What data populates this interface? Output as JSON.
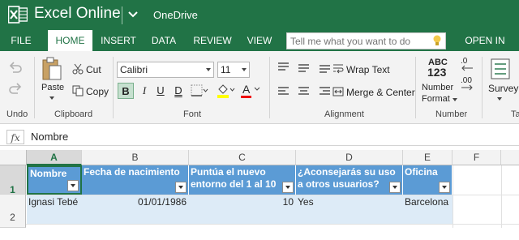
{
  "titlebar": {
    "app_title": "Excel Online",
    "onedrive": "OneDrive",
    "brand_color": "#217346"
  },
  "tabs": [
    {
      "label": "FILE"
    },
    {
      "label": "HOME"
    },
    {
      "label": "INSERT"
    },
    {
      "label": "DATA"
    },
    {
      "label": "REVIEW"
    },
    {
      "label": "VIEW"
    },
    {
      "label": "OPEN IN EXCEL"
    }
  ],
  "active_tab": "HOME",
  "tell_me": {
    "placeholder": "Tell me what you want to do"
  },
  "ribbon": {
    "undo_group": {
      "label": "Undo"
    },
    "clipboard": {
      "label": "Clipboard",
      "paste": "Paste",
      "cut": "Cut",
      "copy": "Copy"
    },
    "font": {
      "label": "Font",
      "font_name": "Calibri",
      "font_size": "11",
      "bold": "B",
      "italic": "I",
      "underline": "U",
      "double_underline": "D",
      "font_color": "A"
    },
    "alignment": {
      "label": "Alignment",
      "wrap_text": "Wrap Text",
      "merge_center": "Merge & Center"
    },
    "number": {
      "label": "Number",
      "number_format_line1": "Number",
      "number_format_line2": "Format",
      "abc": "ABC",
      "num123": "123",
      "dec_inc": ".0",
      "dec_dec": ".00"
    },
    "tables": {
      "survey": "Survey",
      "label_partial": "Ta"
    }
  },
  "formula_bar": {
    "fx": "fx",
    "value": "Nombre"
  },
  "sheet": {
    "columns": [
      "A",
      "B",
      "C",
      "D",
      "E",
      "F"
    ],
    "rows": [
      "1",
      "2"
    ],
    "header_row": [
      "Nombre",
      "Fecha de nacimiento",
      "Puntúa el nuevo entorno del 1 al 10",
      "¿Aconsejarás su uso a otros usuarios?",
      "Oficina"
    ],
    "data_rows": [
      [
        "Ignasi Tebé",
        "01/01/1986",
        "10",
        "Yes",
        "Barcelona"
      ]
    ],
    "table_header_color": "#5b9bd5",
    "table_row_color": "#ddebf7"
  }
}
